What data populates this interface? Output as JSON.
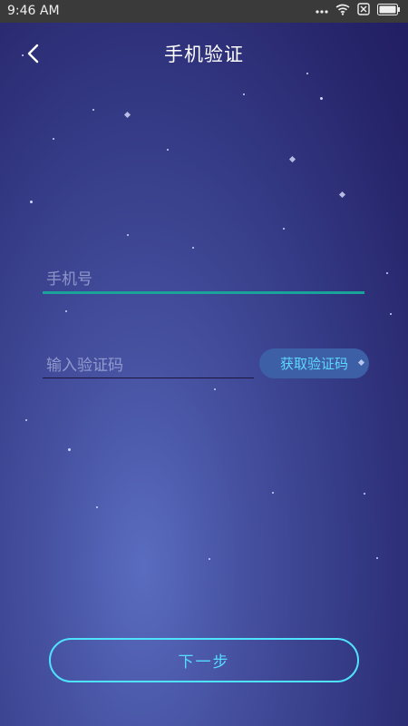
{
  "status_bar": {
    "time": "9:46 AM"
  },
  "header": {
    "title": "手机验证"
  },
  "form": {
    "phone_placeholder": "手机号",
    "code_placeholder": "输入验证码",
    "get_code_label": "获取验证码"
  },
  "actions": {
    "next_label": "下一步"
  },
  "colors": {
    "accent": "#4fe3ff",
    "phone_underline": "#1aa39a",
    "get_code_bg": "#3d5fa6"
  }
}
